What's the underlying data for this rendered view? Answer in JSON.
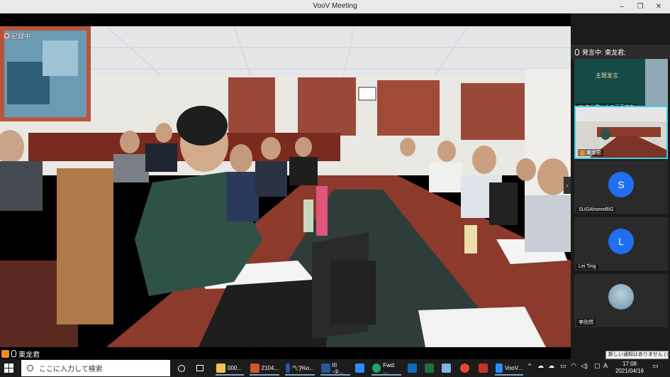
{
  "window": {
    "title": "VooV Meeting"
  },
  "main": {
    "recording_label": "記録中",
    "speaker_badge": "東龙君"
  },
  "sidebar": {
    "speaking": "発言中: 東龙君;",
    "tiles": [
      {
        "label": "東龙君からの画面共有",
        "slide_title": "主题发言"
      },
      {
        "label": "東龙君"
      },
      {
        "label": "SUGAhomeBIG",
        "initial": "S"
      },
      {
        "label": "Lei Ting",
        "initial": "L"
      },
      {
        "label": "李欣然"
      }
    ]
  },
  "taskbar": {
    "search_placeholder": "ここに入力して検索",
    "items": [
      {
        "label": "000...",
        "color": "#f2c24d"
      },
      {
        "label": "2104...",
        "color": "#d35230"
      },
      {
        "label": "^\\;'}%o...",
        "color": "#2b579a"
      },
      {
        "label": "III -②...",
        "color": "#2b579a"
      },
      {
        "label": "",
        "color": "#2d8cff"
      },
      {
        "label": "Fwd: ...",
        "color": "#1fa463"
      },
      {
        "label": "",
        "color": "#0f6cbd"
      },
      {
        "label": "",
        "color": "#1d6f42"
      },
      {
        "label": "",
        "color": "#7fb6e0"
      },
      {
        "label": "",
        "color": "#e8452c"
      },
      {
        "label": "",
        "color": "#c9302c"
      },
      {
        "label": "VooV...",
        "color": "#2d8cff"
      }
    ],
    "tray_text": "A",
    "time": "17:08",
    "date": "2021/04/16"
  },
  "notification": {
    "text": "新しい通知はありません (オフ)"
  }
}
